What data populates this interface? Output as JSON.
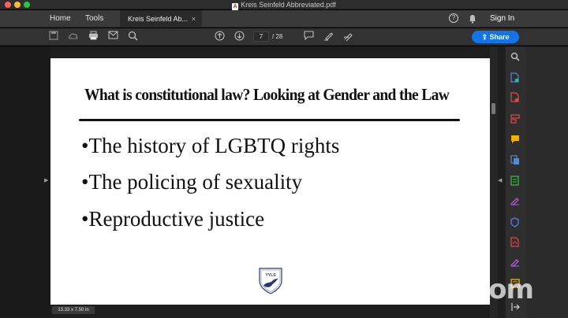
{
  "window": {
    "title": "Kreis Seinfeld Abbreviated.pdf",
    "pdf_badge": "A"
  },
  "tabs": {
    "home": "Home",
    "tools": "Tools",
    "document": "Kreis Seinfeld Ab...",
    "close": "×"
  },
  "header": {
    "help": "?",
    "sign_in": "Sign In"
  },
  "toolbar": {
    "current_page": "7",
    "page_count": "/ 28",
    "share_label": "Share"
  },
  "slide": {
    "title": "What is constitutional law? Looking at Gender and the Law",
    "bullets": [
      "•The history of LGBTQ rights",
      "•The policing of sexuality",
      "•Reproductive justice"
    ],
    "logo_text": "YYLS"
  },
  "status": {
    "page_size": "13.33 x 7.50 in"
  },
  "watermark": {
    "text": "zoom"
  },
  "colors": {
    "accent": "#1473e6",
    "rail_icons": [
      "#4f8bd8",
      "#2fb9a4",
      "#e34850",
      "#e34850",
      "#f2b200",
      "#4f8bd8",
      "#3ab54a",
      "#b35fd8",
      "#5b7be0",
      "#e34850",
      "#b35fd8",
      "#f2b200",
      "#cfcfcf"
    ]
  }
}
